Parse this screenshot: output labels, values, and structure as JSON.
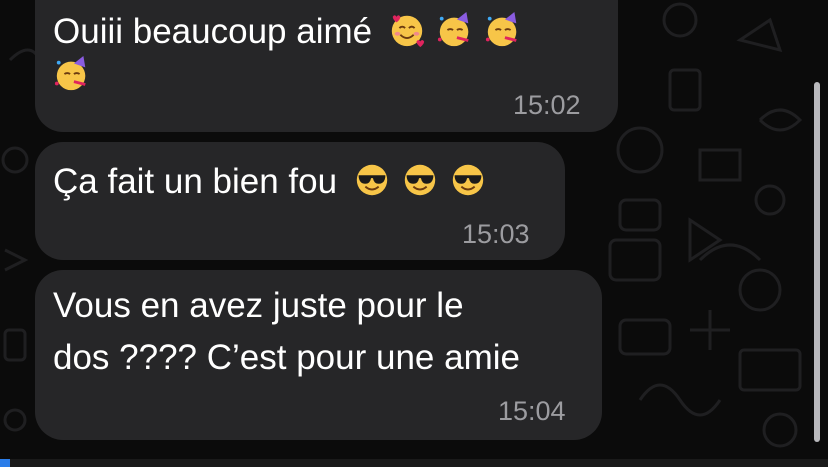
{
  "messages": [
    {
      "text_line1": "Ouiii beaucoup aimé",
      "line1_emojis": [
        "smiling-face-with-hearts",
        "partying-face",
        "partying-face"
      ],
      "line2_emojis": [
        "partying-face"
      ],
      "time": "15:02"
    },
    {
      "text_line1": "Ça fait un bien fou",
      "line1_emojis": [
        "smiling-face-with-sunglasses",
        "smiling-face-with-sunglasses",
        "smiling-face-with-sunglasses"
      ],
      "time": "15:03"
    },
    {
      "text_line1": "Vous en avez juste pour le",
      "text_line2": "dos ???? C’est pour une amie",
      "time": "15:04"
    }
  ],
  "colors": {
    "background": "#0b0b0b",
    "bubble": "#262628",
    "text": "#ffffff",
    "timestamp": "#9c9ca0",
    "doodle": "#1c1c1e"
  }
}
